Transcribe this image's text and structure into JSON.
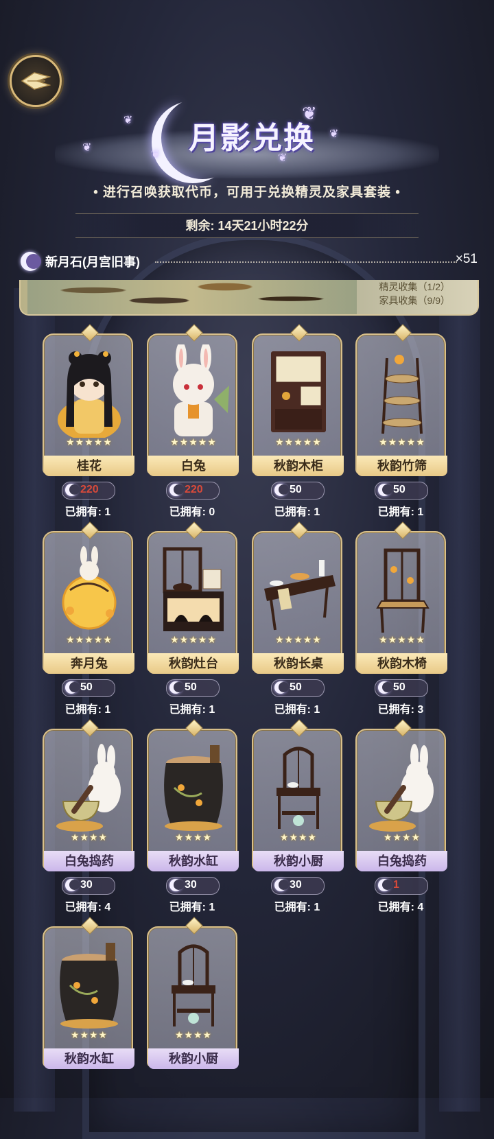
{
  "header": {
    "title": "月影兑换",
    "subtitle": "• 进行召唤获取代币，可用于兑换精灵及家具套装 •",
    "time_left": "剩余: 14天21小时22分"
  },
  "currency": {
    "name": "新月石(月宫旧事)",
    "amount": "×51"
  },
  "banner": {
    "line1": "精灵收集（1/2）",
    "line2": "家具收集（9/9）"
  },
  "items": [
    {
      "name": "桂花",
      "stars": "★★★★★",
      "price": "220",
      "owned": "已拥有: 1",
      "price_red": true,
      "style": "gold",
      "art": "spirit-girl"
    },
    {
      "name": "白兔",
      "stars": "★★★★★",
      "price": "220",
      "owned": "已拥有: 0",
      "price_red": true,
      "style": "gold",
      "art": "spirit-rabbit"
    },
    {
      "name": "秋韵木柜",
      "stars": "★★★★★",
      "price": "50",
      "owned": "已拥有: 1",
      "price_red": false,
      "style": "gold",
      "art": "cabinet"
    },
    {
      "name": "秋韵竹筛",
      "stars": "★★★★★",
      "price": "50",
      "owned": "已拥有: 1",
      "price_red": false,
      "style": "gold",
      "art": "sieve-rack"
    },
    {
      "name": "奔月兔",
      "stars": "★★★★★",
      "price": "50",
      "owned": "已拥有: 1",
      "price_red": false,
      "style": "gold",
      "art": "moon-rabbit"
    },
    {
      "name": "秋韵灶台",
      "stars": "★★★★★",
      "price": "50",
      "owned": "已拥有: 1",
      "price_red": false,
      "style": "gold",
      "art": "stove"
    },
    {
      "name": "秋韵长桌",
      "stars": "★★★★★",
      "price": "50",
      "owned": "已拥有: 1",
      "price_red": false,
      "style": "gold",
      "art": "long-table"
    },
    {
      "name": "秋韵木椅",
      "stars": "★★★★★",
      "price": "50",
      "owned": "已拥有: 3",
      "price_red": false,
      "style": "gold",
      "art": "chair"
    },
    {
      "name": "白兔捣药",
      "stars": "★★★★",
      "price": "30",
      "owned": "已拥有: 4",
      "price_red": false,
      "style": "purple",
      "art": "rabbit-mortar"
    },
    {
      "name": "秋韵水缸",
      "stars": "★★★★",
      "price": "30",
      "owned": "已拥有: 1",
      "price_red": false,
      "style": "purple",
      "art": "water-jar"
    },
    {
      "name": "秋韵小厨",
      "stars": "★★★★",
      "price": "30",
      "owned": "已拥有: 1",
      "price_red": false,
      "style": "purple",
      "art": "small-kitchen"
    },
    {
      "name": "白兔捣药",
      "stars": "★★★★",
      "price": "1",
      "owned": "已拥有: 4",
      "price_red": true,
      "style": "purple",
      "art": "rabbit-mortar"
    },
    {
      "name": "秋韵水缸",
      "stars": "★★★★",
      "price": "",
      "owned": "",
      "price_red": false,
      "style": "purple",
      "art": "water-jar"
    },
    {
      "name": "秋韵小厨",
      "stars": "★★★★",
      "price": "",
      "owned": "",
      "price_red": false,
      "style": "purple",
      "art": "small-kitchen"
    }
  ]
}
